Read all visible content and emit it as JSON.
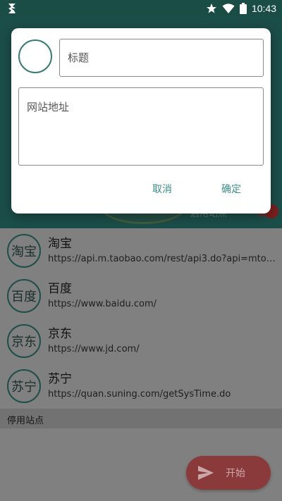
{
  "status_bar": {
    "time": "10:43",
    "icons": [
      "app-notification-icon",
      "star-icon",
      "wifi-icon",
      "battery-icon"
    ]
  },
  "background": {
    "enable_label": "启用站点",
    "sites": [
      {
        "avatar": "淘宝",
        "name": "淘宝",
        "url": "https://api.m.taobao.com/rest/api3.do?api=mtop.common.getTimestamp"
      },
      {
        "avatar": "百度",
        "name": "百度",
        "url": "https://www.baidu.com/"
      },
      {
        "avatar": "京东",
        "name": "京东",
        "url": "https://www.jd.com/"
      },
      {
        "avatar": "苏宁",
        "name": "苏宁",
        "url": "https://quan.suning.com/getSysTime.do"
      }
    ],
    "disabled_section_title": "停用站点",
    "fab": {
      "label": "开始",
      "icon": "send-icon"
    }
  },
  "dialog": {
    "title_placeholder": "标题",
    "title_value": "",
    "url_placeholder": "网站地址",
    "url_value": "",
    "cancel_label": "取消",
    "ok_label": "确定"
  },
  "colors": {
    "accent": "#3a8f86",
    "header": "#1c4e49",
    "fab": "#8a3a3a"
  }
}
